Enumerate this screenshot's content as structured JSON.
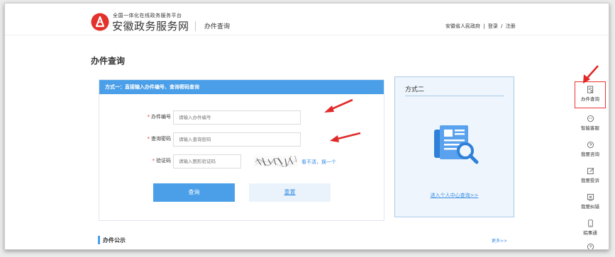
{
  "header": {
    "brand_sub": "全国一体化在线政务服务平台",
    "brand_main": "安徽政务服务网",
    "section": "办件查询",
    "right_org": "安徽省人民政府",
    "right_sep": "|",
    "login": "登录",
    "slash": "/",
    "register": "注册"
  },
  "main": {
    "title": "办件查询",
    "method_one": {
      "heading": "方式一：直接输入办件编号、查询密码查询",
      "fields": [
        {
          "label": "办件编号",
          "placeholder": "请输入办件编号"
        },
        {
          "label": "查询密码",
          "placeholder": "请输入查询密码"
        },
        {
          "label": "验证码",
          "placeholder": "请输入图形验证码"
        }
      ],
      "required_mark": "*",
      "captcha_refresh": "看不清，换一个",
      "query_button": "查询",
      "reset_button": "重置"
    },
    "method_two": {
      "title": "方式二",
      "link": "进入个人中心查询>>"
    },
    "public": {
      "title": "办件公示",
      "more": "更多>>"
    }
  },
  "sidebar": {
    "items": [
      {
        "label": "办件查询",
        "icon": "document-search-icon"
      },
      {
        "label": "智能客服",
        "icon": "chat-bot-icon"
      },
      {
        "label": "我要咨询",
        "icon": "consult-icon"
      },
      {
        "label": "我要投诉",
        "icon": "complaint-edit-icon"
      },
      {
        "label": "我要纠错",
        "icon": "error-correct-icon"
      },
      {
        "label": "皖事通",
        "icon": "mobile-app-icon"
      }
    ]
  },
  "colors": {
    "primary": "#4a9fe8",
    "link": "#3a8ee6",
    "logo_red": "#e2322b",
    "annotation_red": "#e02a2a"
  }
}
